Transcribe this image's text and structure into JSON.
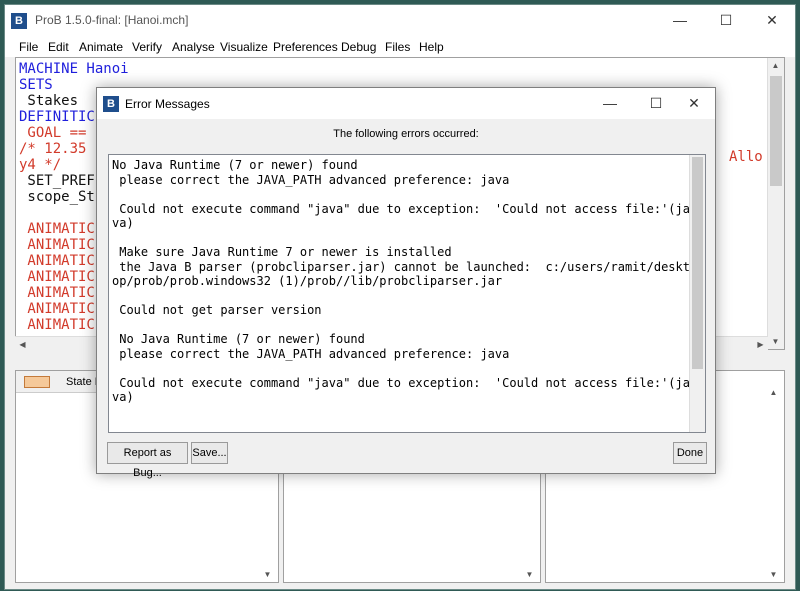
{
  "window": {
    "title": "ProB 1.5.0-final: [Hanoi.mch]",
    "icon": "prob-logo-icon",
    "minimize": "—",
    "maximize": "☐",
    "close": "✕"
  },
  "menu": [
    "File",
    "Edit",
    "Animate",
    "Verify",
    "Analyse",
    "Visualize",
    "Preferences",
    "Debug",
    "Files",
    "Help"
  ],
  "editor": {
    "lines": [
      {
        "text": "MACHINE Hanoi",
        "color": "#1f1fdc"
      },
      {
        "text": "SETS",
        "color": "#1f1fdc"
      },
      {
        "text": " Stakes",
        "color": "#111111"
      },
      {
        "text": "DEFINITIC",
        "color": "#1f1fdc"
      },
      {
        "text": " GOAL ==",
        "color": "#d23a2a"
      },
      {
        "text": "/* 12.35",
        "color": "#d23a2a"
      },
      {
        "text": "y4 */",
        "color": "#d23a2a"
      },
      {
        "text": " SET_PREF",
        "color": "#111111"
      },
      {
        "text": " scope_St",
        "color": "#111111"
      },
      {
        "text": "",
        "color": "#111111"
      },
      {
        "text": " ANIMATIC",
        "color": "#d23a2a"
      },
      {
        "text": " ANIMATIC",
        "color": "#d23a2a"
      },
      {
        "text": " ANIMATIC",
        "color": "#d23a2a"
      },
      {
        "text": " ANIMATIC",
        "color": "#d23a2a"
      },
      {
        "text": " ANIMATIC",
        "color": "#d23a2a"
      },
      {
        "text": " ANIMATIC",
        "color": "#d23a2a"
      },
      {
        "text": " ANIMATIC",
        "color": "#d23a2a"
      }
    ],
    "right_fragment": "Allo"
  },
  "panes": {
    "state_label": "State P"
  },
  "dialog": {
    "title": "Error Messages",
    "header": "The following errors occurred:",
    "message": "No Java Runtime (7 or newer) found\n please correct the JAVA_PATH advanced preference: java\n\n Could not execute command \"java\" due to exception:  'Could not access file:'(ja\nva)\n\n Make sure Java Runtime 7 or newer is installed\n the Java B parser (probcliparser.jar) cannot be launched:  c:/users/ramit/deskt\nop/prob/prob.windows32 (1)/prob//lib/probcliparser.jar\n\n Could not get parser version\n\n No Java Runtime (7 or newer) found\n please correct the JAVA_PATH advanced preference: java\n\n Could not execute command \"java\" due to exception:  'Could not access file:'(ja\nva)",
    "buttons": {
      "report": "Report as Bug...",
      "save": "Save...",
      "done": "Done"
    }
  }
}
